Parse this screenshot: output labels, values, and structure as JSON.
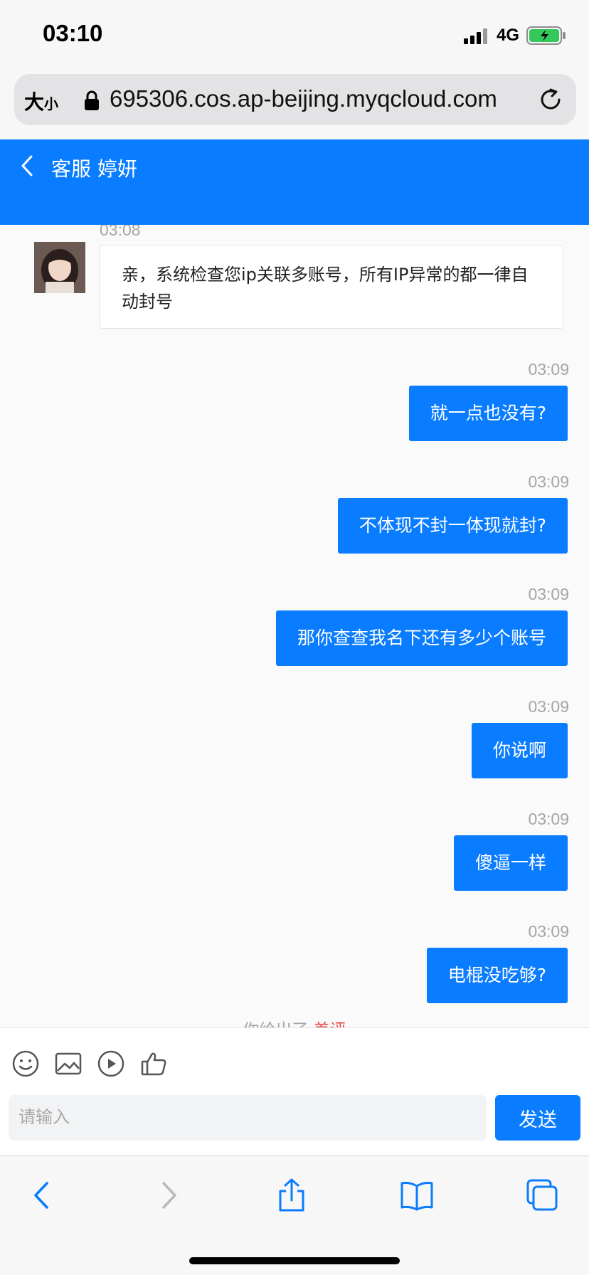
{
  "status_bar": {
    "time": "03:10",
    "network": "4G"
  },
  "url_bar": {
    "text_size_big": "大",
    "text_size_small": "小",
    "url": "695306.cos.ap-beijing.myqcloud.com"
  },
  "header": {
    "title": "客服 婷妍"
  },
  "messages": {
    "incoming": {
      "time": "03:08",
      "text": "亲，系统检查您ip关联多账号，所有IP异常的都一律自动封号"
    },
    "outgoing": [
      {
        "time": "03:09",
        "text": "就一点也没有?"
      },
      {
        "time": "03:09",
        "text": "不体现不封一体现就封?"
      },
      {
        "time": "03:09",
        "text": "那你查查我名下还有多少个账号"
      },
      {
        "time": "03:09",
        "text": "你说啊"
      },
      {
        "time": "03:09",
        "text": "傻逼一样"
      },
      {
        "time": "03:09",
        "text": "电棍没吃够?"
      }
    ],
    "tip_prefix": "你给出了",
    "tip_highlight": "差评"
  },
  "composer": {
    "placeholder": "请输入",
    "send_label": "发送"
  },
  "icons": [
    "emoji-icon",
    "image-icon",
    "video-icon",
    "thumbs-up-icon",
    "back-arrow-icon",
    "forward-arrow-icon",
    "share-icon",
    "bookmarks-icon",
    "tabs-icon"
  ],
  "colors": {
    "accent": "#0a7cff",
    "tip_highlight": "#e84b4b",
    "battery": "#34c759"
  }
}
